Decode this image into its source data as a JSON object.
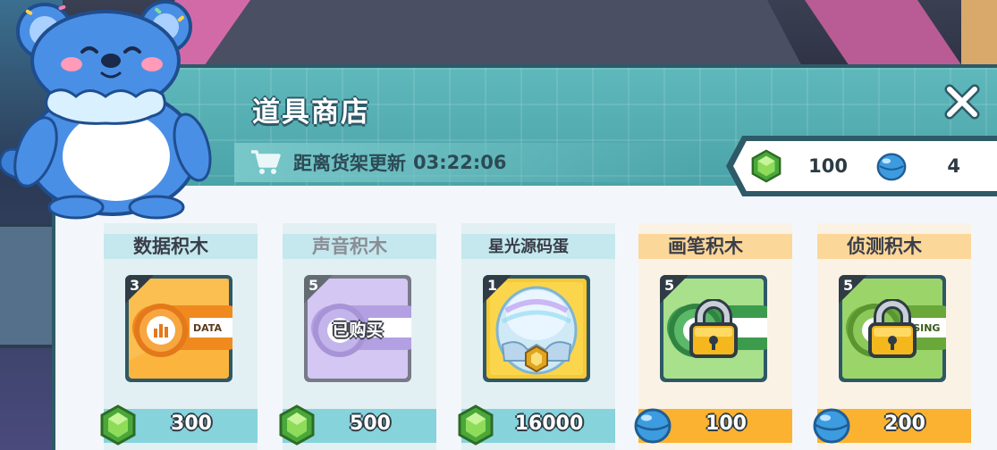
{
  "shop": {
    "title": "道具商店",
    "refresh_label": "距离货架更新",
    "refresh_time": "03:22:06"
  },
  "currency": {
    "gem_count": "100",
    "orb_count": "4",
    "gem_icon": "green-gem-icon",
    "orb_icon": "blue-orb-icon"
  },
  "items": [
    {
      "name": "数据积木",
      "count": "3",
      "price": "300",
      "currency": "gem",
      "state": "available",
      "card_text": "DATA"
    },
    {
      "name": "声音积木",
      "count": "5",
      "price": "500",
      "currency": "gem",
      "state": "purchased",
      "status_label": "已购买"
    },
    {
      "name": "星光源码蛋",
      "count": "1",
      "price": "16000",
      "currency": "gem",
      "state": "available"
    },
    {
      "name": "画笔积木",
      "count": "5",
      "price": "100",
      "currency": "orb",
      "state": "locked"
    },
    {
      "name": "侦测积木",
      "count": "5",
      "price": "200",
      "currency": "orb",
      "state": "locked",
      "card_text": "NSING"
    }
  ],
  "colors": {
    "header": "#5fb8bb",
    "panel_border": "#2e5a68",
    "gem_price_bar": "#86d3dc",
    "orb_price_bar": "#fbb231",
    "orange_card": "#f7a640",
    "purple_card": "#a98de6",
    "gold_card": "#f6c532",
    "green_card": "#7fcf6e"
  }
}
